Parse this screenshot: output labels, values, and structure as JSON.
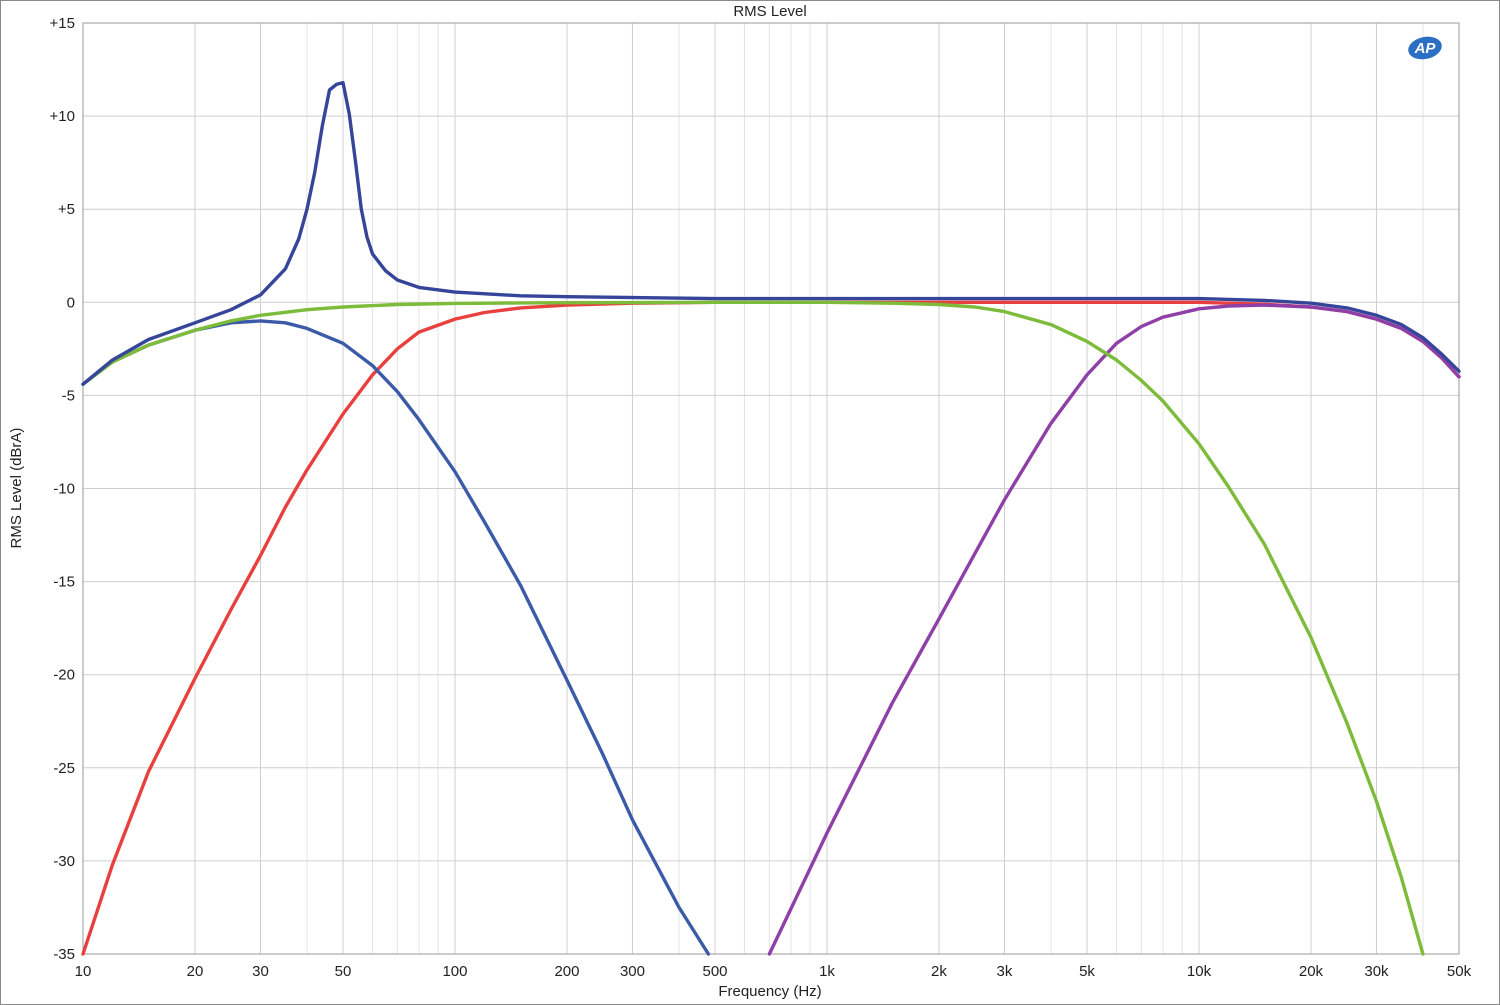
{
  "chart_data": {
    "type": "line",
    "title": "RMS Level",
    "xlabel": "Frequency (Hz)",
    "ylabel": "RMS Level (dBrA)",
    "x_scale": "log",
    "xlim": [
      10,
      50000
    ],
    "ylim": [
      -35,
      15
    ],
    "grid": true,
    "logo_text": "AP",
    "x_ticks": [
      {
        "value": 10,
        "label": "10"
      },
      {
        "value": 20,
        "label": "20"
      },
      {
        "value": 30,
        "label": "30"
      },
      {
        "value": 50,
        "label": "50"
      },
      {
        "value": 100,
        "label": "100"
      },
      {
        "value": 200,
        "label": "200"
      },
      {
        "value": 300,
        "label": "300"
      },
      {
        "value": 500,
        "label": "500"
      },
      {
        "value": 1000,
        "label": "1k"
      },
      {
        "value": 2000,
        "label": "2k"
      },
      {
        "value": 3000,
        "label": "3k"
      },
      {
        "value": 5000,
        "label": "5k"
      },
      {
        "value": 10000,
        "label": "10k"
      },
      {
        "value": 20000,
        "label": "20k"
      },
      {
        "value": 30000,
        "label": "30k"
      },
      {
        "value": 50000,
        "label": "50k"
      }
    ],
    "y_ticks": [
      {
        "value": 15,
        "label": "+15"
      },
      {
        "value": 10,
        "label": "+10"
      },
      {
        "value": 5,
        "label": "+5"
      },
      {
        "value": 0,
        "label": "0"
      },
      {
        "value": -5,
        "label": "-5"
      },
      {
        "value": -10,
        "label": "-10"
      },
      {
        "value": -15,
        "label": "-15"
      },
      {
        "value": -20,
        "label": "-20"
      },
      {
        "value": -25,
        "label": "-25"
      },
      {
        "value": -30,
        "label": "-30"
      },
      {
        "value": -35,
        "label": "-35"
      }
    ],
    "series": [
      {
        "color": "#e8403f",
        "x": [
          10,
          12,
          15,
          20,
          25,
          30,
          35,
          40,
          50,
          60,
          70,
          80,
          100,
          120,
          150,
          200,
          300,
          500,
          1000,
          2000,
          5000,
          10000,
          15000,
          20000,
          25000,
          30000,
          35000,
          40000,
          45000,
          50000
        ],
        "y": [
          -35,
          -30.2,
          -25.2,
          -20.2,
          -16.5,
          -13.6,
          -11.0,
          -9.0,
          -6.0,
          -3.9,
          -2.5,
          -1.6,
          -0.9,
          -0.55,
          -0.3,
          -0.15,
          -0.05,
          0,
          0,
          0,
          0,
          0,
          -0.1,
          -0.25,
          -0.5,
          -0.9,
          -1.4,
          -2.1,
          -3.0,
          -4.0
        ]
      },
      {
        "color": "#3b5ba8",
        "x": [
          10,
          12,
          15,
          20,
          25,
          30,
          35,
          40,
          50,
          60,
          70,
          80,
          100,
          120,
          150,
          200,
          250,
          300,
          400,
          480
        ],
        "y": [
          -4.4,
          -3.2,
          -2.3,
          -1.5,
          -1.1,
          -1.0,
          -1.1,
          -1.4,
          -2.2,
          -3.4,
          -4.8,
          -6.3,
          -9.1,
          -11.8,
          -15.2,
          -20.3,
          -24.3,
          -27.8,
          -32.5,
          -35
        ]
      },
      {
        "color": "#8e3fa8",
        "x": [
          700,
          1000,
          1500,
          2000,
          3000,
          4000,
          5000,
          6000,
          7000,
          8000,
          10000,
          12000,
          15000,
          20000,
          25000,
          30000,
          35000,
          40000,
          45000,
          50000
        ],
        "y": [
          -35,
          -28.5,
          -21.5,
          -17.0,
          -10.6,
          -6.5,
          -3.9,
          -2.2,
          -1.3,
          -0.8,
          -0.35,
          -0.2,
          -0.15,
          -0.25,
          -0.5,
          -0.9,
          -1.4,
          -2.1,
          -3.0,
          -4.0
        ]
      },
      {
        "color": "#7dbb3a",
        "x": [
          10,
          12,
          15,
          20,
          25,
          30,
          40,
          50,
          70,
          100,
          150,
          200,
          500,
          1000,
          1500,
          2000,
          2500,
          3000,
          4000,
          5000,
          6000,
          7000,
          8000,
          10000,
          12000,
          15000,
          20000,
          25000,
          30000,
          35000,
          40000
        ],
        "y": [
          -4.4,
          -3.2,
          -2.3,
          -1.5,
          -1.0,
          -0.7,
          -0.4,
          -0.25,
          -0.12,
          -0.06,
          -0.03,
          -0.02,
          0,
          0,
          -0.05,
          -0.12,
          -0.25,
          -0.5,
          -1.2,
          -2.1,
          -3.1,
          -4.2,
          -5.3,
          -7.6,
          -9.9,
          -13.0,
          -18.0,
          -22.6,
          -26.8,
          -30.9,
          -35
        ]
      },
      {
        "color": "#35459a",
        "x": [
          10,
          12,
          15,
          20,
          25,
          30,
          35,
          38,
          40,
          42,
          44,
          46,
          48,
          50,
          52,
          54,
          56,
          58,
          60,
          65,
          70,
          80,
          100,
          150,
          200,
          500,
          1000,
          5000,
          10000,
          15000,
          20000,
          25000,
          30000,
          35000,
          40000,
          45000,
          50000
        ],
        "y": [
          -4.4,
          -3.1,
          -2.0,
          -1.1,
          -0.4,
          0.4,
          1.8,
          3.4,
          5.0,
          7.0,
          9.5,
          11.4,
          11.7,
          11.8,
          10.1,
          7.6,
          5.0,
          3.5,
          2.6,
          1.7,
          1.2,
          0.8,
          0.55,
          0.35,
          0.3,
          0.2,
          0.2,
          0.2,
          0.2,
          0.1,
          -0.05,
          -0.3,
          -0.7,
          -1.2,
          -1.9,
          -2.8,
          -3.7
        ]
      }
    ]
  }
}
